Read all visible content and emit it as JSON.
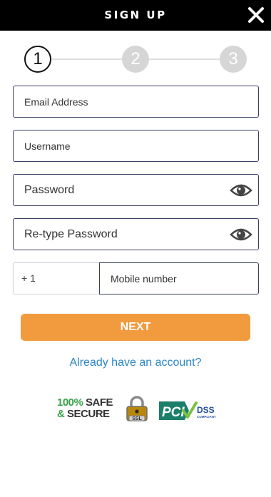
{
  "header": {
    "title": "SIGN UP"
  },
  "steps": [
    "1",
    "2",
    "3"
  ],
  "form": {
    "email_placeholder": "Email Address",
    "username_placeholder": "Username",
    "password_placeholder": "Password",
    "retype_placeholder": "Re-type Password",
    "country_code": "+ 1",
    "mobile_placeholder": "Mobile number"
  },
  "actions": {
    "next_label": "NEXT",
    "account_link": "Already have an account?"
  },
  "badges": {
    "safe_line1_pct": "100%",
    "safe_line1_word": "SAFE",
    "safe_line2_amp": "&",
    "safe_line2_word": "SECURE",
    "ssl_label": "SSL",
    "pci_label": "PCI",
    "dss_label": "DSS",
    "compliant_label": "COMPLIANT"
  },
  "colors": {
    "header_bg": "#000000",
    "accent_orange": "#f29a3e",
    "link_blue": "#2b86c5",
    "field_border": "#3b3f63",
    "badge_green": "#3aa34a",
    "pci_teal": "#1b7f6a"
  },
  "icons": {
    "close": "close-icon",
    "eye": "eye-icon",
    "ssl": "padlock-icon",
    "pci": "checkmark-icon"
  }
}
